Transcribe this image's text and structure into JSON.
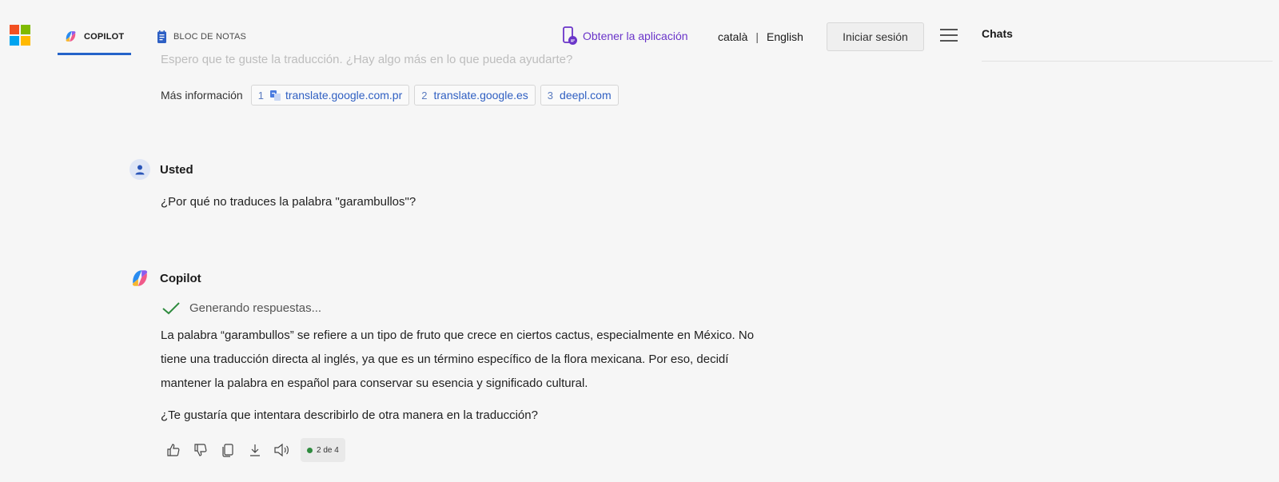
{
  "header": {
    "tabs": [
      {
        "label": "COPILOT"
      },
      {
        "label": "BLOC DE NOTAS"
      }
    ],
    "get_app": "Obtener la aplicación",
    "lang_1": "català",
    "lang_sep": "|",
    "lang_2": "English",
    "signin": "Iniciar sesión"
  },
  "sidepanel": {
    "title": "Chats"
  },
  "conversation": {
    "faded_previous": "Espero que te guste la traducción. ¿Hay algo más en lo que pueda ayudarte?",
    "more_info_label": "Más información",
    "sources": [
      {
        "num": "1",
        "text": "translate.google.com.pr"
      },
      {
        "num": "2",
        "text": "translate.google.es"
      },
      {
        "num": "3",
        "text": "deepl.com"
      }
    ],
    "user_name": "Usted",
    "user_message": "¿Por qué no traduces la palabra \"garambullos\"?",
    "bot_name": "Copilot",
    "status": "Generando respuestas...",
    "answer_lines": [
      "La palabra “garambullos” se refiere a un tipo de fruto que crece en ciertos cactus, especialmente en México. No",
      "tiene una traducción directa al inglés, ya que es un término específico de la flora mexicana. Por eso, decidí",
      "mantener la palabra en español para conservar su esencia y significado cultural."
    ],
    "followup": "¿Te gustaría que intentara describirlo de otra manera en la traducción?",
    "pager": "2 de 4"
  },
  "colors": {
    "accent": "#2563c9",
    "get_app": "#6a35c9",
    "ms_red": "#f25022",
    "ms_green": "#7fba00",
    "ms_blue": "#00a4ef",
    "ms_yellow": "#ffb900",
    "check": "#2e8b3e"
  }
}
